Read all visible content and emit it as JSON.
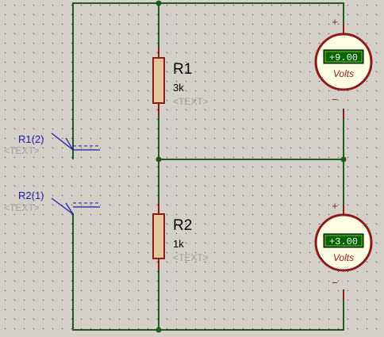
{
  "colors": {
    "background": "#d4d0c8",
    "grid_dot": "#2a2a2a",
    "wire": "#1f5a1f",
    "component_body": "#e5c59b",
    "component_outline": "#8b1a1a",
    "meter_face": "#ffffe6",
    "lcd_bg": "#006400",
    "probe": "#1a1aa6"
  },
  "resistors": [
    {
      "ref": "R1",
      "value": "3k",
      "placeholder": "<TEXT>"
    },
    {
      "ref": "R2",
      "value": "1k",
      "placeholder": "<TEXT>"
    }
  ],
  "voltmeters": [
    {
      "reading": "+9.00",
      "unit": "Volts",
      "plus": "+",
      "minus": "−"
    },
    {
      "reading": "+3.00",
      "unit": "Volts",
      "plus": "+",
      "minus": "−"
    }
  ],
  "probes": [
    {
      "name": "R1(2)",
      "placeholder": "<TEXT>"
    },
    {
      "name": "R2(1)",
      "placeholder": "<TEXT>"
    }
  ],
  "icons": {
    "grid": "dot-grid",
    "resistor": "resistor-icon",
    "voltmeter": "voltmeter-icon",
    "probe": "voltage-probe-icon"
  }
}
